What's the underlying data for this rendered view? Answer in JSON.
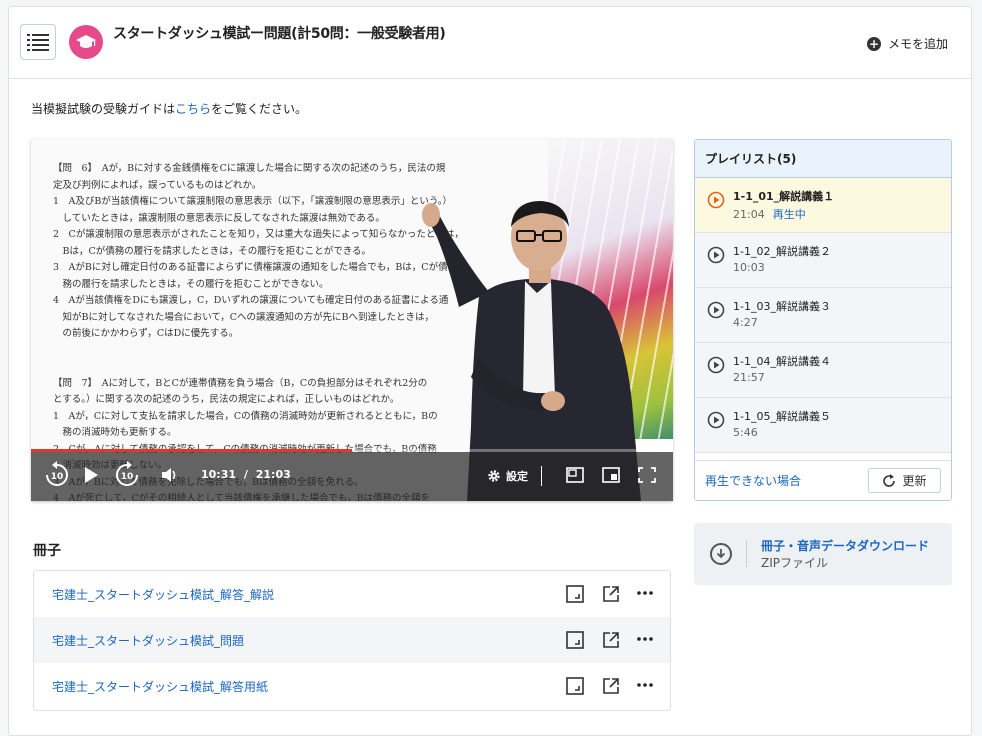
{
  "header": {
    "title": "スタートダッシュ模試ー問題(計50問：一般受験者用)",
    "memo_label": "メモを追加"
  },
  "guide": {
    "before": "当模擬試験の受験ガイドは",
    "link": "こちら",
    "after": "をご覧ください。"
  },
  "video": {
    "current_time": "10:31",
    "separator": "/",
    "duration": "21:03",
    "progress_fraction": 0.4995,
    "settings_label": "設定",
    "skip_seconds": "10",
    "slide_lines": [
      "【問　6】　Aが，Bに対する金銭債権をCに譲渡した場合に関する次の記述のうち，民法の規",
      "定及び判例によれば，誤っているものはどれか。",
      "1　A及びBが当該債権について譲渡制限の意思表示（以下，「譲渡制限の意思表示」という。）",
      "　していたときは，譲渡制限の意思表示に反してなされた譲渡は無効である。",
      "2　Cが譲渡制限の意思表示がされたことを知り，又は重大な過失によって知らなかったときは，",
      "　Bは，Cが債務の履行を請求したときは，その履行を拒むことができる。",
      "3　AがBに対し確定日付のある証書によらずに債権譲渡の通知をした場合でも，Bは，Cが債",
      "　務の履行を請求したときは，その履行を拒むことができない。",
      "4　Aが当該債権をDにも譲渡し，C，Dいずれの譲渡についても確定日付のある証書による通",
      "　知がBに対してなされた場合において，Cへの譲渡通知の方が先にBへ到達したときは，",
      "　の前後にかかわらず，CはDに優先する。",
      "",
      "",
      "【問　7】　Aに対して，BとCが連帯債務を負う場合（B，Cの負担部分はそれぞれ2分の",
      "とする。）に関する次の記述のうち，民法の規定によれば，正しいものはどれか。",
      "1　Aが，Cに対して支払を請求した場合，Cの債務の消滅時効が更新されるとともに，Bの",
      "　務の消滅時効も更新する。",
      "2　Cが，Aに対して債務の承認をして，Cの債務の消滅時効が更新した場合でも，Bの債務",
      "　消滅時効は更新しない。",
      "3　Aが，Bに対して債務を免除した場合でも，Bは債務の全額を免れる。",
      "4　Aが死亡して，Cがその相続人として当該債権を承継した場合でも，Bは債務の全額を"
    ]
  },
  "playlist": {
    "title": "プレイリスト(5)",
    "items": [
      {
        "title": "1-1_01_解説講義１",
        "duration": "21:04",
        "status": "再生中",
        "active": true
      },
      {
        "title": "1-1_02_解説講義２",
        "duration": "10:03"
      },
      {
        "title": "1-1_03_解説講義３",
        "duration": "4:27"
      },
      {
        "title": "1-1_04_解説講義４",
        "duration": "21:57"
      },
      {
        "title": "1-1_05_解説講義５",
        "duration": "5:46"
      }
    ],
    "cannot_play": "再生できない場合",
    "refresh_label": "更新"
  },
  "booklets": {
    "title": "冊子",
    "items": [
      {
        "name": "宅建士_スタートダッシュ模試_解答_解説"
      },
      {
        "name": "宅建士_スタートダッシュ模試_問題"
      },
      {
        "name": "宅建士_スタートダッシュ模試_解答用紙"
      }
    ]
  },
  "download": {
    "title": "冊子・音声データダウンロード",
    "subtitle": "ZIPファイル"
  },
  "colors": {
    "accent_pink": "#e64a8a",
    "link_blue": "#1a66c2",
    "progress_red": "#e0392b",
    "playing_orange": "#e0651a"
  }
}
